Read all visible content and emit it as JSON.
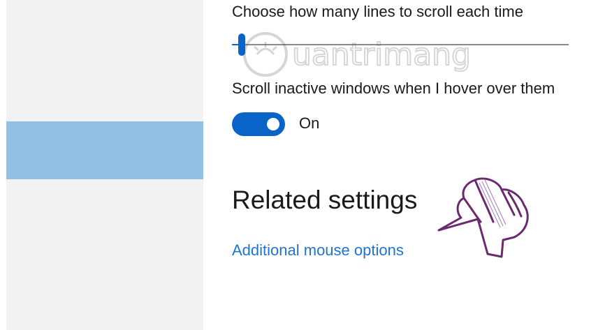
{
  "settings": {
    "scroll_lines": {
      "label": "Choose how many lines to scroll each time",
      "slider_level": 0.03
    },
    "scroll_inactive": {
      "label": "Scroll inactive windows when I hover over them",
      "state_text": "On"
    }
  },
  "related": {
    "heading": "Related settings",
    "additional_mouse_options": "Additional mouse options"
  },
  "decorations": {
    "watermark_logo": "Quantrimang",
    "pointer_icon": "hand-pointing-icon"
  },
  "colors": {
    "accent": "#0a64c8",
    "link": "#1f75cc",
    "sidebar": "#f2f2f2",
    "sidebar_selected": "#93c1e6",
    "hand_outline": "#6b2a6d"
  }
}
